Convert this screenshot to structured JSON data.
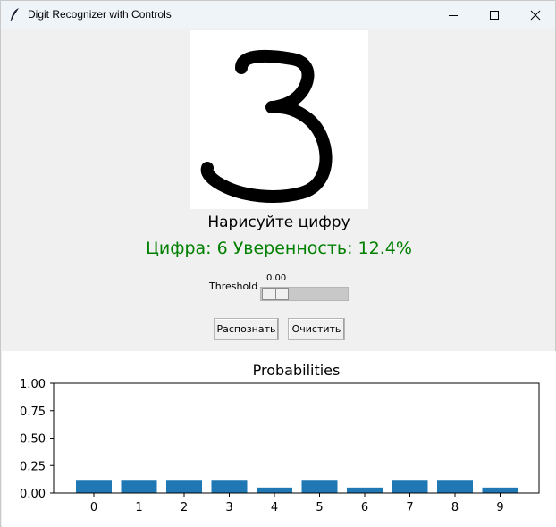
{
  "window": {
    "title": "Digit Recognizer with Controls",
    "icon": "feather-icon",
    "controls": [
      "minimize-icon",
      "maximize-icon",
      "close-icon"
    ]
  },
  "canvas": {
    "drawn_digit": "3",
    "stroke_color": "#000000",
    "background": "#ffffff"
  },
  "prompt": "Нарисуйте цифру",
  "result": {
    "text": "Цифра: 6 Уверенность: 12.4%",
    "color": "#008000"
  },
  "threshold": {
    "label": "Threshold",
    "value_text": "0.00",
    "value": 0.0
  },
  "buttons": {
    "recognize": "Распознать",
    "clear": "Очистить"
  },
  "chart_data": {
    "type": "bar",
    "title": "Probabilities",
    "xlabel": "",
    "ylabel": "",
    "categories": [
      "0",
      "1",
      "2",
      "3",
      "4",
      "5",
      "6",
      "7",
      "8",
      "9"
    ],
    "values": [
      0.12,
      0.12,
      0.12,
      0.12,
      0.05,
      0.12,
      0.05,
      0.12,
      0.12,
      0.05
    ],
    "ylim": [
      0,
      1
    ],
    "yticks": [
      "0.00",
      "0.25",
      "0.50",
      "0.75",
      "1.00"
    ],
    "bar_color": "#1f77b4",
    "grid": false
  }
}
